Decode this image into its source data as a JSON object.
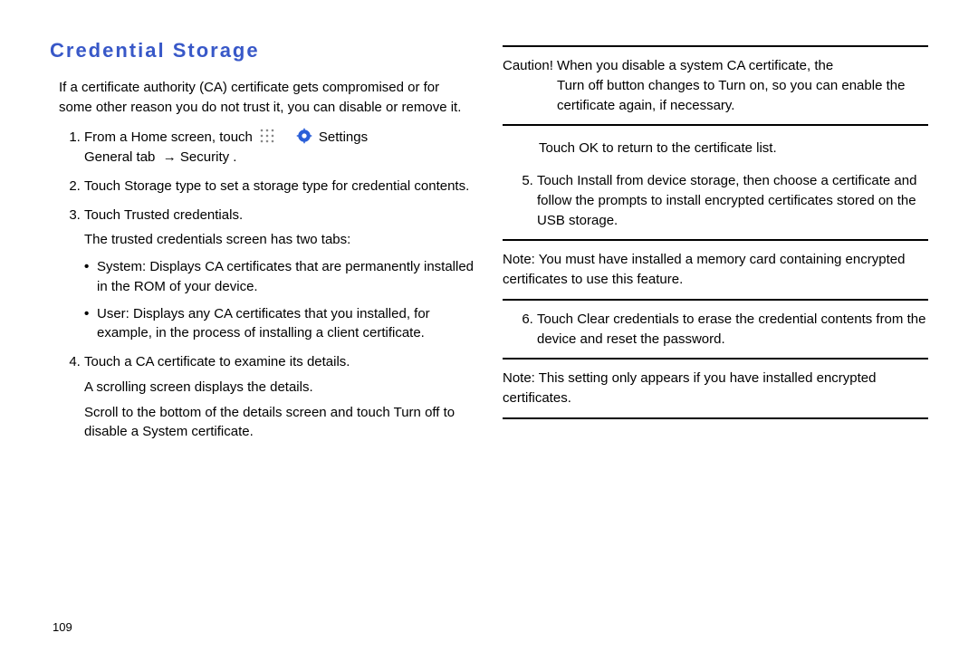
{
  "title": "Credential Storage",
  "intro": "If a certificate authority (CA) certificate gets compromised or for some other reason you do not trust it, you can disable or remove it.",
  "step1": {
    "text": "From a Home screen, touch",
    "settings": "Settings",
    "general_tab": "General",
    "tab_word": "tab",
    "arrow": "→",
    "security": "Security ."
  },
  "step2": {
    "a": "Touch ",
    "bold": "Storage type",
    "b": " to set a storage type for credential contents."
  },
  "step3": {
    "a": "Touch ",
    "bold": "Trusted credentials",
    "b": ".",
    "sub": "The trusted credentials screen has two tabs:"
  },
  "bullets": {
    "sys_label": "System",
    "sys_text": ": Displays CA certificates that are permanently installed in the ROM of your device.",
    "user_label": "User",
    "user_text": ": Displays any CA certificates that you installed, for example, in the process of installing a client certificate."
  },
  "step4": {
    "a": "Touch a CA certificate to examine its details.",
    "b": "A scrolling screen displays the details.",
    "c1": "Scroll to the bottom of the details screen and touch ",
    "c_bold": "Turn off",
    "c2": " to disable a System certificate."
  },
  "caution": {
    "label": "Caution!",
    "a": " When you disable a system CA certificate, the ",
    "b1": "Turn off",
    "mid": " button changes to ",
    "b2": "Turn on",
    "c": ", so you can enable the certificate again, if necessary."
  },
  "ok_line": {
    "a": "Touch ",
    "bold": "OK",
    "b": " to return to the certificate list."
  },
  "step5": {
    "a": "Touch ",
    "bold": "Install from device storage",
    "b": ", then choose a certificate and follow the prompts to install encrypted certificates stored on the USB storage."
  },
  "note1": {
    "label": "Note:",
    "text": " You must have installed a memory card containing encrypted certificates to use this feature."
  },
  "step6": {
    "a": "Touch ",
    "bold": "Clear credentials",
    "b": " to erase the credential contents from the device and reset the password."
  },
  "note2": {
    "label": "Note:",
    "text": " This setting only appears if you have installed encrypted certificates."
  },
  "page_number": "109"
}
